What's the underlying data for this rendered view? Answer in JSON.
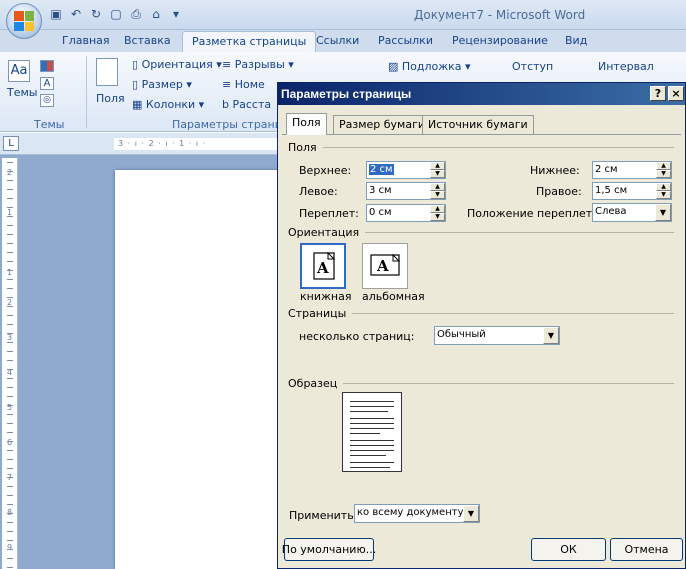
{
  "window": {
    "title": "Документ7 - Microsoft Word",
    "tabs": [
      "Главная",
      "Вставка",
      "Разметка страницы",
      "Ссылки",
      "Рассылки",
      "Рецензирование",
      "Вид"
    ],
    "active_tab": "Разметка страницы"
  },
  "ribbon": {
    "themes_label": "Темы",
    "themes_group": "Темы",
    "fields_label": "Поля",
    "orientation": "Ориентация",
    "breaks": "Разрывы",
    "size": "Размер",
    "line_numbers": "Номе",
    "columns": "Колонки",
    "hyphenation": "Расста",
    "page_setup_group": "Параметры страницы",
    "watermark": "Подложка",
    "indent": "Отступ",
    "spacing": "Интервал"
  },
  "ruler": {
    "h_text": "3 · ı · 2 · ı · 1 · ı · ",
    "v_numbers": [
      "2",
      "1",
      "1",
      "2",
      "3",
      "4",
      "5",
      "6",
      "7",
      "8",
      "9"
    ]
  },
  "dialog": {
    "title": "Параметры страницы",
    "help_btn": "?",
    "close_btn": "×",
    "tabs": [
      "Поля",
      "Размер бумаги",
      "Источник бумаги"
    ],
    "margins_section": "Поля",
    "top_label": "Верхнее:",
    "top_value": "2 см",
    "bottom_label": "Нижнее:",
    "bottom_value": "2 см",
    "left_label": "Левое:",
    "left_value": "3 см",
    "right_label": "Правое:",
    "right_value": "1,5 см",
    "gutter_label": "Переплет:",
    "gutter_value": "0 см",
    "gutter_pos_label": "Положение переплета:",
    "gutter_pos_value": "Слева",
    "orientation_section": "Ориентация",
    "portrait": "книжная",
    "landscape": "альбомная",
    "pages_section": "Страницы",
    "multiple_pages_label": "несколько страниц:",
    "multiple_pages_value": "Обычный",
    "preview_section": "Образец",
    "apply_label": "Применить:",
    "apply_value": "ко всему документу",
    "default_btn": "По умолчанию...",
    "ok_btn": "ОК",
    "cancel_btn": "Отмена"
  },
  "colors": {
    "title_bar": "#0a246a",
    "dialog_bg": "#ece9d8",
    "selection": "#316ac5",
    "workspace": "#8fa9cf"
  }
}
